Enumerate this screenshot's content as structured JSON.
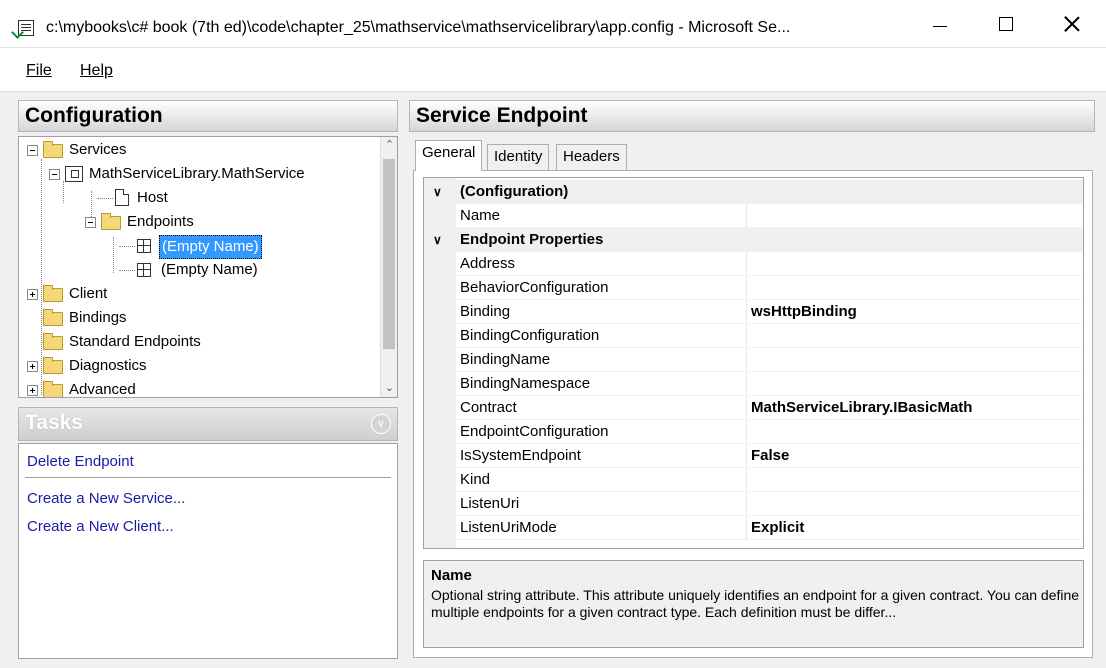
{
  "window": {
    "title": "c:\\mybooks\\c# book (7th ed)\\code\\chapter_25\\mathservice\\mathservicelibrary\\app.config - Microsoft Se..."
  },
  "menu": {
    "file_label": "File",
    "help_label": "Help"
  },
  "configuration": {
    "header": "Configuration",
    "tree": [
      {
        "label": "Services"
      },
      {
        "label": "MathServiceLibrary.MathService"
      },
      {
        "label": "Host"
      },
      {
        "label": "Endpoints"
      },
      {
        "label": "(Empty Name)",
        "selected": true
      },
      {
        "label": "(Empty Name)"
      },
      {
        "label": "Client"
      },
      {
        "label": "Bindings"
      },
      {
        "label": "Standard Endpoints"
      },
      {
        "label": "Diagnostics"
      },
      {
        "label": "Advanced"
      }
    ]
  },
  "tasks": {
    "header": "Tasks",
    "links": [
      "Delete Endpoint",
      "Create a New Service...",
      "Create a New Client..."
    ]
  },
  "endpoint": {
    "header": "Service Endpoint",
    "tabs": [
      "General",
      "Identity",
      "Headers"
    ],
    "active_tab": "General",
    "categories": [
      {
        "name": "(Configuration)",
        "properties": [
          {
            "name": "Name",
            "value": ""
          }
        ]
      },
      {
        "name": "Endpoint Properties",
        "properties": [
          {
            "name": "Address",
            "value": ""
          },
          {
            "name": "BehaviorConfiguration",
            "value": ""
          },
          {
            "name": "Binding",
            "value": "wsHttpBinding"
          },
          {
            "name": "BindingConfiguration",
            "value": ""
          },
          {
            "name": "BindingName",
            "value": ""
          },
          {
            "name": "BindingNamespace",
            "value": ""
          },
          {
            "name": "Contract",
            "value": "MathServiceLibrary.IBasicMath"
          },
          {
            "name": "EndpointConfiguration",
            "value": ""
          },
          {
            "name": "IsSystemEndpoint",
            "value": "False"
          },
          {
            "name": "Kind",
            "value": ""
          },
          {
            "name": "ListenUri",
            "value": ""
          },
          {
            "name": "ListenUriMode",
            "value": "Explicit"
          }
        ]
      }
    ],
    "description": {
      "title": "Name",
      "text": "Optional string attribute. This attribute uniquely identifies an endpoint for a given contract. You can define multiple endpoints for a given contract type. Each definition must be differ..."
    }
  }
}
